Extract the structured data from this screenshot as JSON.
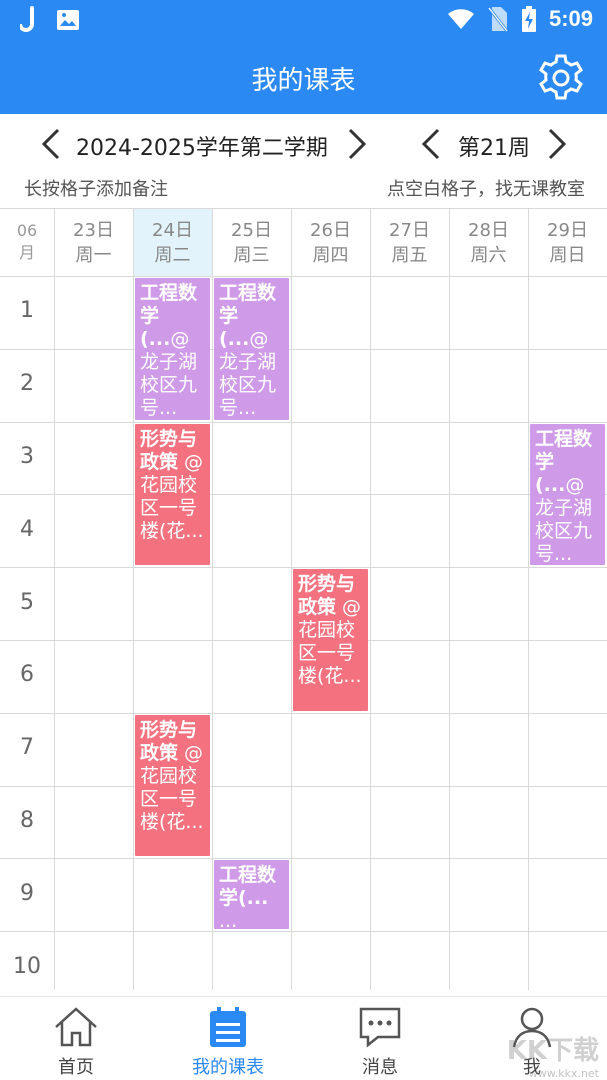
{
  "status_bar": {
    "time": "5:09",
    "left_icons": [
      "j-app-icon",
      "image-icon"
    ],
    "right_icons": [
      "wifi-icon",
      "no-sim-icon",
      "battery-charging-icon"
    ]
  },
  "app_bar": {
    "title": "我的课表",
    "settings_icon": "gear-icon"
  },
  "term_selector": {
    "term": "2024-2025学年第二学期",
    "week": "第21周"
  },
  "hints": {
    "left": "长按格子添加备注",
    "right": "点空白格子，找无课教室"
  },
  "grid": {
    "month": "06",
    "month_unit": "月",
    "days": [
      {
        "date": "23日",
        "weekday": "周一",
        "active": false
      },
      {
        "date": "24日",
        "weekday": "周二",
        "active": true
      },
      {
        "date": "25日",
        "weekday": "周三",
        "active": false
      },
      {
        "date": "26日",
        "weekday": "周四",
        "active": false
      },
      {
        "date": "27日",
        "weekday": "周五",
        "active": false
      },
      {
        "date": "28日",
        "weekday": "周六",
        "active": false
      },
      {
        "date": "29日",
        "weekday": "周日",
        "active": false
      }
    ],
    "periods": [
      "1",
      "2",
      "3",
      "4",
      "5",
      "6",
      "7",
      "8",
      "9",
      "10"
    ]
  },
  "courses": [
    {
      "day": 2,
      "start": 1,
      "span": 2,
      "color": "#cf9be8",
      "name": "工程数学(...",
      "location": "@龙子湖校区九号..."
    },
    {
      "day": 3,
      "start": 1,
      "span": 2,
      "color": "#cf9be8",
      "name": "工程数学(...",
      "location": "@龙子湖校区九号..."
    },
    {
      "day": 2,
      "start": 3,
      "span": 2,
      "color": "#f4727f",
      "name": "形势与政策",
      "location": " @花园校区一号楼(花..."
    },
    {
      "day": 7,
      "start": 3,
      "span": 2,
      "color": "#cf9be8",
      "name": "工程数学(...",
      "location": "@龙子湖校区九号..."
    },
    {
      "day": 4,
      "start": 5,
      "span": 2,
      "color": "#f4727f",
      "name": "形势与政策",
      "location": " @花园校区一号楼(花..."
    },
    {
      "day": 2,
      "start": 7,
      "span": 2,
      "color": "#f4727f",
      "name": "形势与政策",
      "location": " @花园校区一号楼(花..."
    },
    {
      "day": 3,
      "start": 9,
      "span": 1,
      "color": "#cf9be8",
      "name": "工程数学(...",
      "location": " ..."
    }
  ],
  "bottom_nav": [
    {
      "label": "首页",
      "icon": "home-icon",
      "active": false
    },
    {
      "label": "我的课表",
      "icon": "calendar-icon",
      "active": true
    },
    {
      "label": "消息",
      "icon": "message-icon",
      "active": false
    },
    {
      "label": "我",
      "icon": "user-icon",
      "active": false
    }
  ],
  "watermark": {
    "text": "KK下载",
    "url": "www.kkx.net"
  }
}
